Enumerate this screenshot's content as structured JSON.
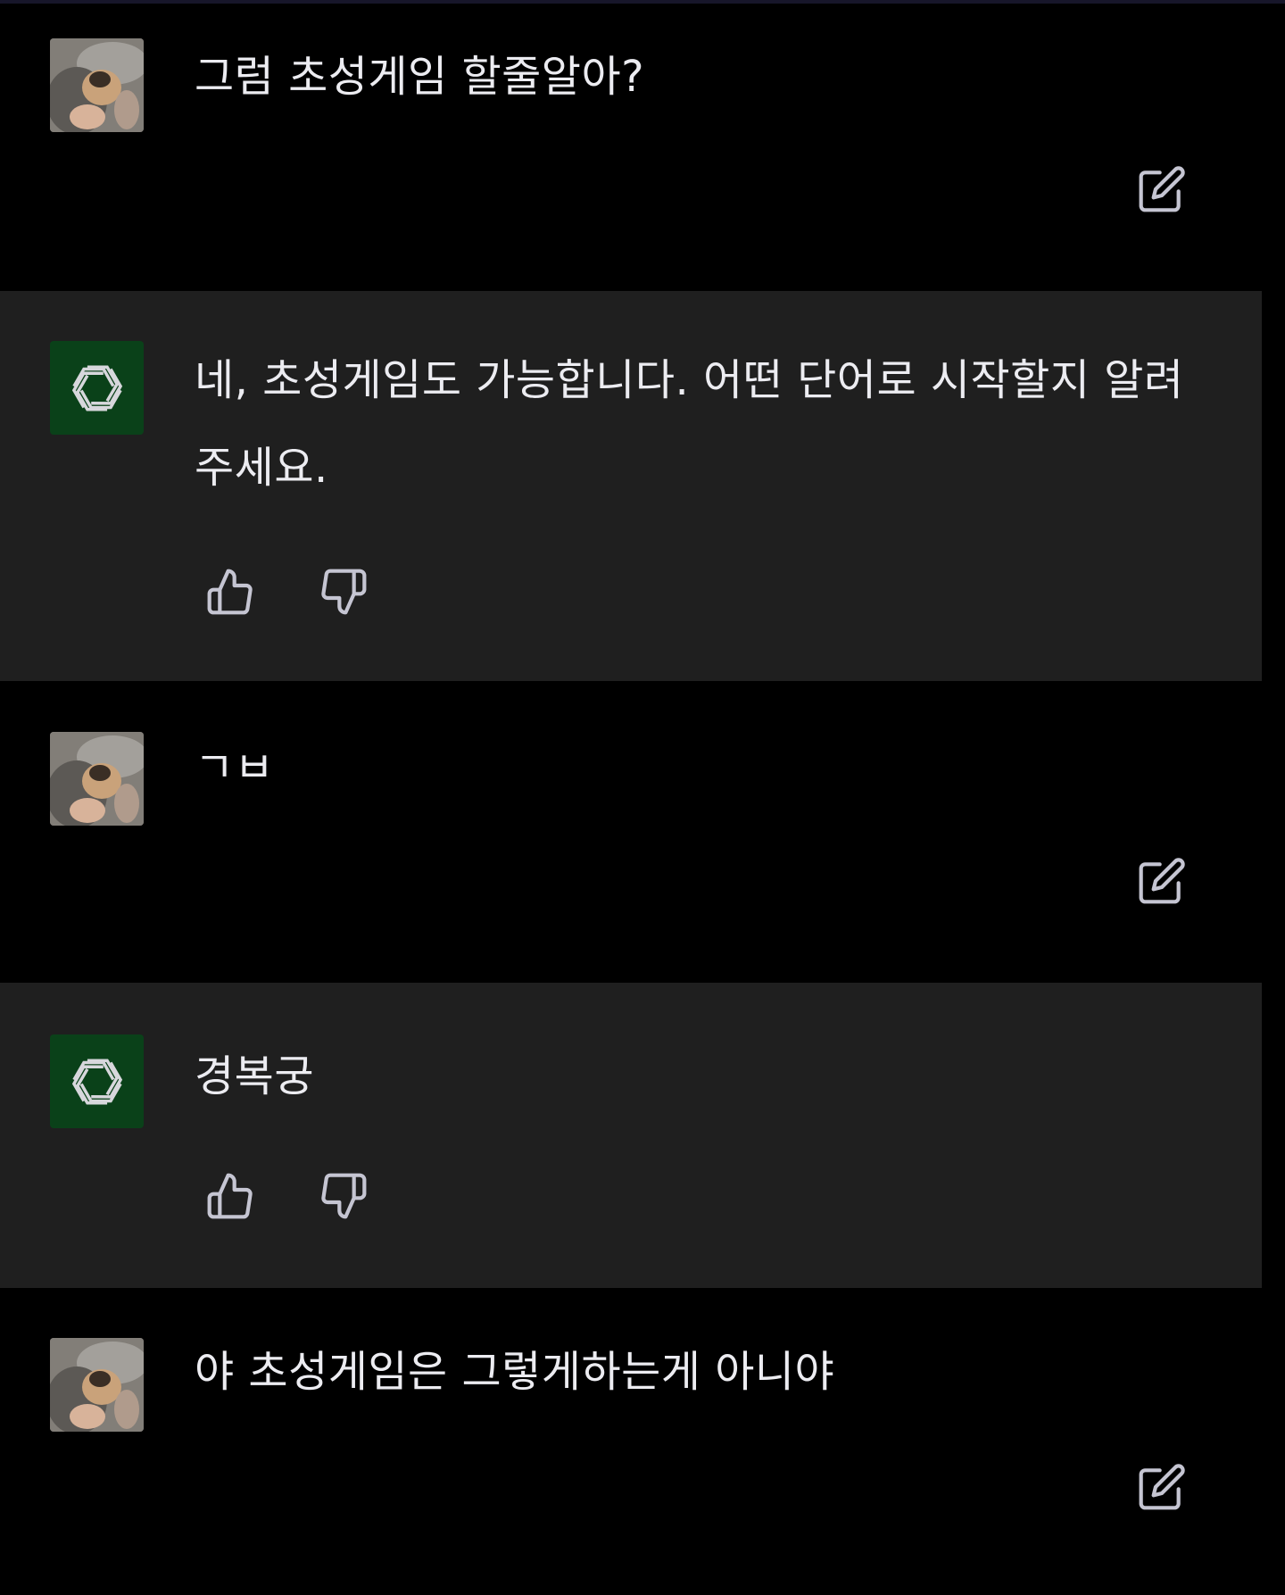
{
  "conversation": {
    "messages": [
      {
        "role": "user",
        "text": "그럼 초성게임 할줄알아?",
        "avatar": "pug-photo",
        "action_icon": "edit-icon"
      },
      {
        "role": "assistant",
        "text": "네, 초성게임도 가능합니다. 어떤 단어로 시작할지 알려주세요.",
        "avatar": "openai-logo-icon",
        "action_icons": [
          "thumbs-up-icon",
          "thumbs-down-icon"
        ]
      },
      {
        "role": "user",
        "text": "ㄱㅂ",
        "avatar": "pug-photo",
        "action_icon": "edit-icon"
      },
      {
        "role": "assistant",
        "text": "경복궁",
        "avatar": "openai-logo-icon",
        "action_icons": [
          "thumbs-up-icon",
          "thumbs-down-icon"
        ]
      },
      {
        "role": "user",
        "text": "야 초성게임은 그렇게하는게 아니야",
        "avatar": "pug-photo",
        "action_icon": "edit-icon"
      }
    ]
  },
  "colors": {
    "user_bg": "#000000",
    "assistant_bg": "#1f1f1f",
    "assistant_avatar_bg": "#0a4119",
    "text": "#ececf1",
    "icon": "#c5c5d2"
  }
}
